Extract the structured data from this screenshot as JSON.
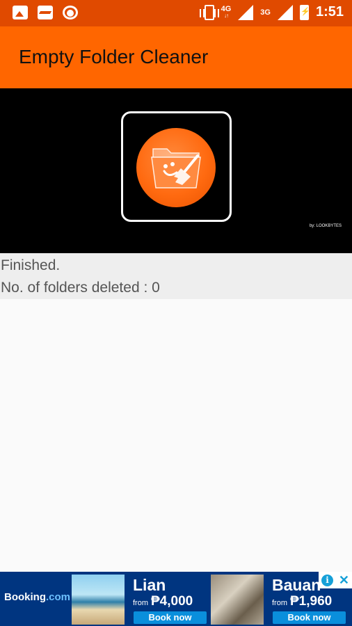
{
  "status_bar": {
    "network_type": "4G",
    "network_type_2": "3G",
    "time": "1:51",
    "notification_icons": [
      "image-icon",
      "pulse-icon",
      "record-icon"
    ]
  },
  "app_bar": {
    "title": "Empty Folder Cleaner"
  },
  "banner": {
    "brand": "by: LOOKBYTES"
  },
  "status": {
    "line1": "Finished.",
    "line2": "No. of folders deleted : 0"
  },
  "ad": {
    "logo_main": "Booking",
    "logo_suffix": ".com",
    "items": [
      {
        "name": "Lian",
        "from": "from",
        "price": "₱4,000",
        "cta": "Book now"
      },
      {
        "name": "Bauan",
        "from": "from",
        "price": "₱1,960",
        "cta": "Book now"
      }
    ],
    "info_glyph": "i",
    "close_glyph": "✕"
  },
  "colors": {
    "status_bar": "#e04a00",
    "app_bar": "#ff6600",
    "ad_background": "#003580"
  }
}
